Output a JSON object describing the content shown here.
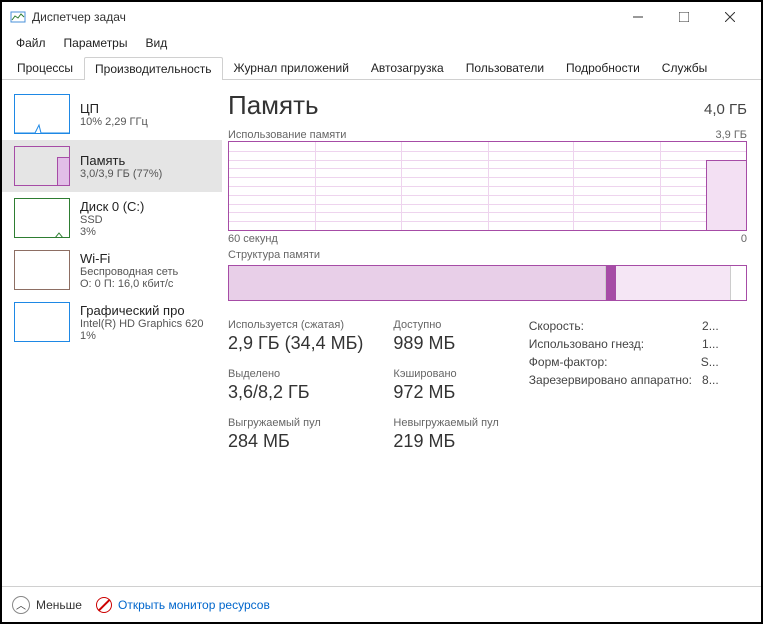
{
  "window": {
    "title": "Диспетчер задач"
  },
  "menu": {
    "file": "Файл",
    "options": "Параметры",
    "view": "Вид"
  },
  "tabs": {
    "processes": "Процессы",
    "performance": "Производительность",
    "apphistory": "Журнал приложений",
    "startup": "Автозагрузка",
    "users": "Пользователи",
    "details": "Подробности",
    "services": "Службы"
  },
  "sidebar": {
    "cpu": {
      "title": "ЦП",
      "sub": "10% 2,29 ГГц",
      "color": "#1e88e5"
    },
    "memory": {
      "title": "Память",
      "sub": "3,0/3,9 ГБ (77%)",
      "color": "#a64ca6"
    },
    "disk": {
      "title": "Диск 0 (C:)",
      "sub1": "SSD",
      "sub2": "3%",
      "color": "#2e7d32"
    },
    "wifi": {
      "title": "Wi-Fi",
      "sub1": "Беспроводная сеть",
      "sub2": "О: 0 П: 16,0 кбит/с",
      "color": "#8d6e63"
    },
    "gpu": {
      "title": "Графический про",
      "sub1": "Intel(R) HD Graphics 620",
      "sub2": "1%",
      "color": "#1e88e5"
    }
  },
  "main": {
    "title": "Память",
    "total": "4,0 ГБ",
    "usage_label": "Использование памяти",
    "usage_max": "3,9 ГБ",
    "axis_left": "60 секунд",
    "axis_right": "0",
    "composition_label": "Структура памяти",
    "stats": {
      "inuse_label": "Используется (сжатая)",
      "inuse_value": "2,9 ГБ (34,4 МБ)",
      "available_label": "Доступно",
      "available_value": "989 МБ",
      "committed_label": "Выделено",
      "committed_value": "3,6/8,2 ГБ",
      "cached_label": "Кэшировано",
      "cached_value": "972 МБ",
      "paged_label": "Выгружаемый пул",
      "paged_value": "284 МБ",
      "nonpaged_label": "Невыгружаемый пул",
      "nonpaged_value": "219 МБ"
    },
    "specs": {
      "speed_label": "Скорость:",
      "speed_value": "2...",
      "slots_label": "Использовано гнезд:",
      "slots_value": "1...",
      "form_label": "Форм-фактор:",
      "form_value": "S...",
      "reserved_label": "Зарезервировано аппаратно:",
      "reserved_value": "8..."
    }
  },
  "bottom": {
    "fewer": "Меньше",
    "open_monitor": "Открыть монитор ресурсов"
  },
  "chart_data": {
    "type": "area",
    "title": "Использование памяти",
    "xlabel": "60 секунд → 0",
    "ylabel": "ГБ",
    "ylim": [
      0,
      3.9
    ],
    "x": [
      60,
      55,
      50,
      45,
      40,
      35,
      30,
      25,
      20,
      15,
      10,
      5,
      0
    ],
    "values": [
      0,
      0,
      0,
      0,
      0,
      0,
      0,
      0,
      0,
      0,
      0,
      3.0,
      3.0
    ],
    "composition_segments": [
      {
        "name": "in-use",
        "fraction": 0.73,
        "color": "#e1bee7"
      },
      {
        "name": "modified",
        "fraction": 0.02,
        "color": "#a64ca6"
      },
      {
        "name": "standby",
        "fraction": 0.22,
        "color": "#f5e6f5"
      },
      {
        "name": "free",
        "fraction": 0.03,
        "color": "#ffffff"
      }
    ]
  }
}
